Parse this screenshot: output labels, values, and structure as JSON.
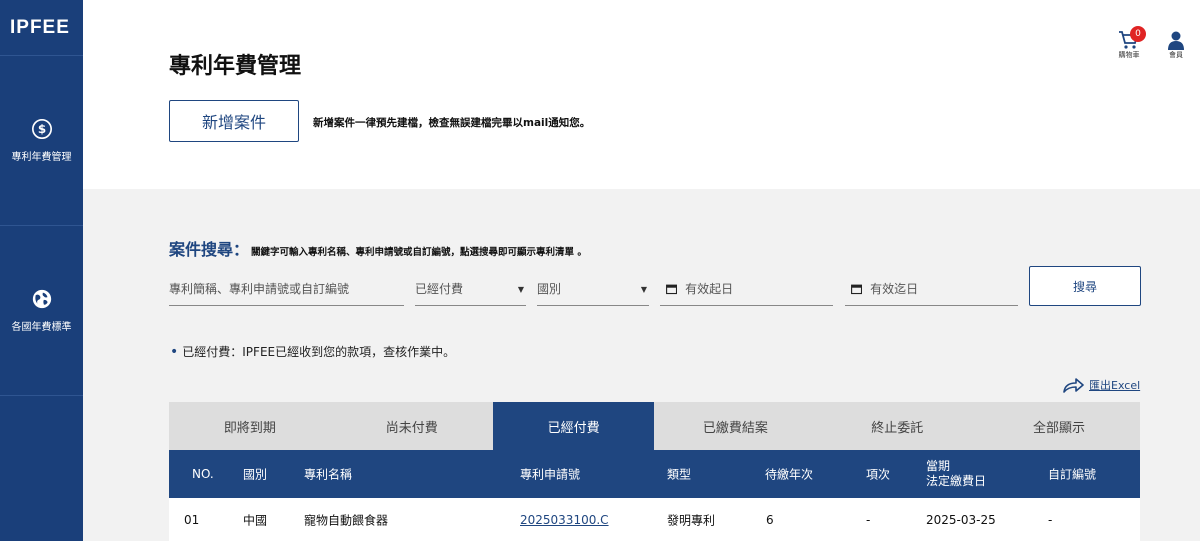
{
  "app": {
    "logo": "IPFEE"
  },
  "sidebar": {
    "items": [
      {
        "label": "專利年費管理",
        "icon": "dollar-circle-icon"
      },
      {
        "label": "各國年費標準",
        "icon": "globe-icon"
      }
    ]
  },
  "header": {
    "title": "專利年費管理",
    "add_button": "新增案件",
    "add_note": "新增案件一律預先建檔，檢查無誤建檔完畢以mail通知您。",
    "cart": {
      "label": "購物車",
      "count": "0"
    },
    "member": {
      "label": "會員"
    }
  },
  "search": {
    "heading": "案件搜尋：",
    "description": "關鍵字可輸入專利名稱、專利申請號或自訂編號，點選搜尋即可顯示專利清單 。",
    "keyword_placeholder": "專利簡稱、專利申請號或自訂編號",
    "status_value": "已經付費",
    "country_value": "國別",
    "start_placeholder": "有效起日",
    "end_placeholder": "有效迄日",
    "button": "搜尋"
  },
  "status_note": "已經付費：IPFEE已經收到您的款項，查核作業中。",
  "export_label": "匯出Excel",
  "tabs": [
    {
      "label": "即將到期"
    },
    {
      "label": "尚未付費"
    },
    {
      "label": "已經付費",
      "active": true
    },
    {
      "label": "已繳費結案"
    },
    {
      "label": "終止委託"
    },
    {
      "label": "全部顯示"
    }
  ],
  "table": {
    "headers": [
      "NO.",
      "國別",
      "專利名稱",
      "專利申請號",
      "類型",
      "待繳年次",
      "項次",
      "當期",
      "法定繳費日",
      "自訂編號"
    ],
    "rows": [
      [
        "01",
        "中國",
        "寵物自動餵食器",
        "2025033100.C",
        "發明專利",
        "6",
        "-",
        "2025-03-25",
        "-"
      ]
    ]
  },
  "colors": {
    "primary": "#1f4680",
    "sidebar": "#1a3f7a",
    "badge": "#e02424"
  }
}
